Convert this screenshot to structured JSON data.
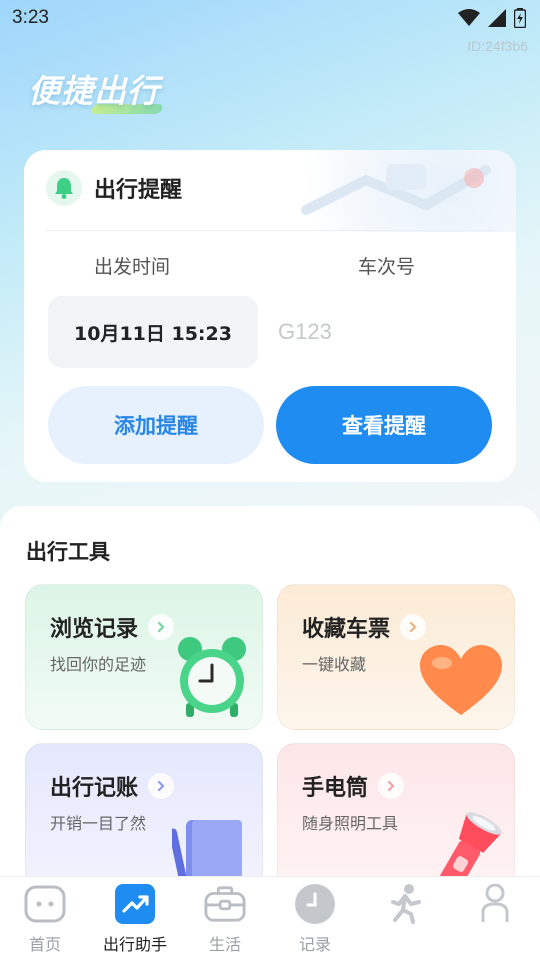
{
  "status_bar": {
    "time": "3:23"
  },
  "id_tag": "ID:24f3b6",
  "brand": {
    "title": "便捷出行"
  },
  "reminder": {
    "title": "出行提醒",
    "departure_label": "出发时间",
    "train_label": "车次号",
    "departure_value": "10月11日 15:23",
    "train_placeholder": "G123",
    "add_button": "添加提醒",
    "view_button": "查看提醒"
  },
  "tools": {
    "title": "出行工具",
    "items": [
      {
        "title": "浏览记录",
        "subtitle": "找回你的足迹",
        "icon": "alarm-clock-icon"
      },
      {
        "title": "收藏车票",
        "subtitle": "一键收藏",
        "icon": "heart-icon"
      },
      {
        "title": "出行记账",
        "subtitle": "开销一目了然",
        "icon": "notebook-icon"
      },
      {
        "title": "手电筒",
        "subtitle": "随身照明工具",
        "icon": "flashlight-icon"
      }
    ]
  },
  "bottom_nav": {
    "items": [
      {
        "label": "首页",
        "icon": "home-icon"
      },
      {
        "label": "出行助手",
        "icon": "trend-icon",
        "active": true
      },
      {
        "label": "生活",
        "icon": "briefcase-icon"
      },
      {
        "label": "记录",
        "icon": "clock-icon"
      },
      {
        "label": "",
        "icon": "runner-icon"
      },
      {
        "label": "",
        "icon": "profile-icon"
      }
    ]
  },
  "colors": {
    "accent": "#1e8cf0",
    "accent_light": "#e6f1fd",
    "bell_green": "#3dcf86"
  }
}
